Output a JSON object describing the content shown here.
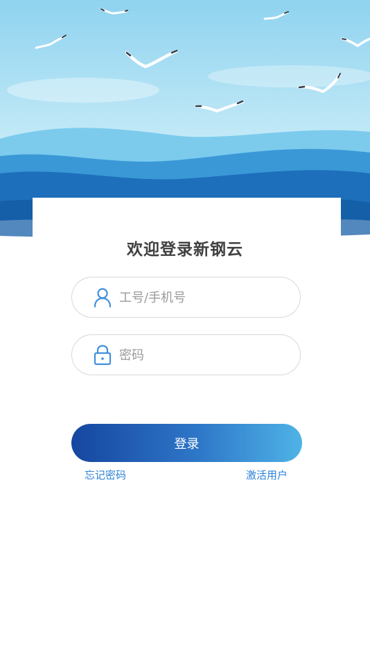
{
  "login": {
    "title": "欢迎登录新钢云",
    "account_placeholder": "工号/手机号",
    "password_placeholder": "密码",
    "submit_label": "登录",
    "forgot_password": "忘记密码",
    "activate_user": "激活用户"
  },
  "icons": {
    "account": "user-icon",
    "password": "lock-icon"
  },
  "colors": {
    "primary_start": "#1646a0",
    "primary_end": "#4fb3e6",
    "link": "#2d82d6",
    "title_text": "#3f3f3f"
  }
}
